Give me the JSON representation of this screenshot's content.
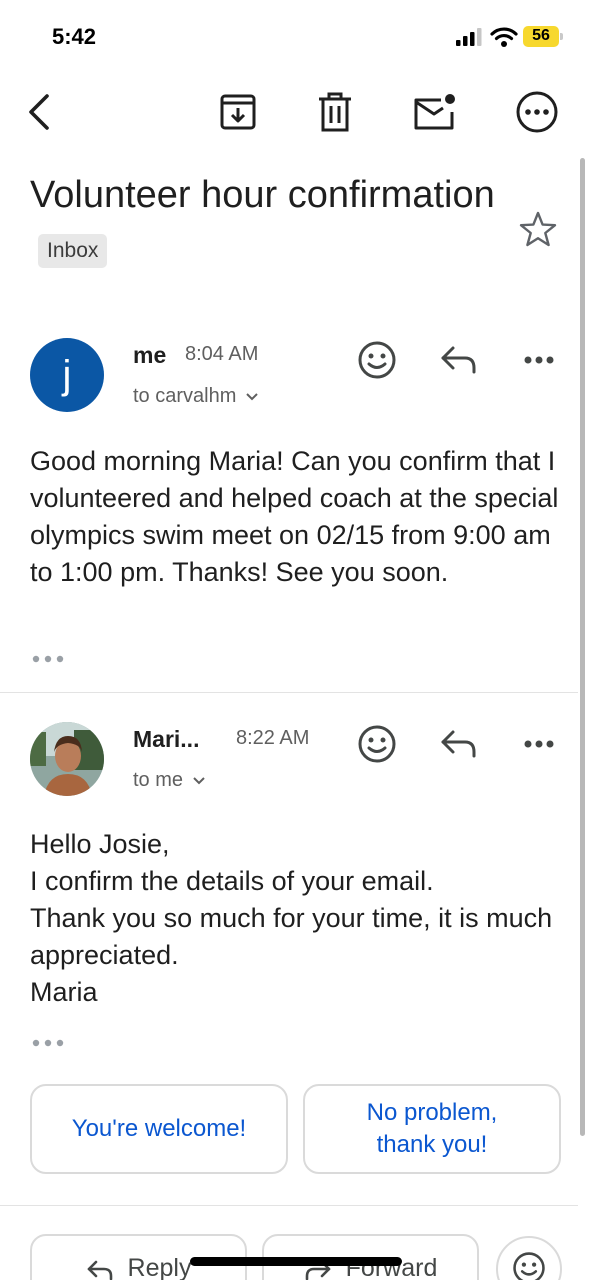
{
  "status_bar": {
    "time": "5:42",
    "battery_level": "56",
    "battery_color": "#f7d82e"
  },
  "toolbar": {
    "back_icon": "chevron-left-icon",
    "archive_icon": "archive-icon",
    "delete_icon": "trash-icon",
    "mark_unread_icon": "mail-unread-icon",
    "more_icon": "more-horizontal-icon"
  },
  "subject": {
    "title": "Volunteer hour confirmation",
    "label": "Inbox"
  },
  "messages": [
    {
      "avatar_letter": "j",
      "avatar_color": "#0b57a5",
      "sender": "me",
      "time": "8:04 AM",
      "recipient": "to carvalhm",
      "body": "Good morning Maria! Can you confirm that I volunteered and helped coach at the special olympics swim meet on 02/15 from 9:00 am to 1:00 pm. Thanks! See you soon."
    },
    {
      "avatar_image": "profile-photo",
      "sender": "Mari...",
      "time": "8:22 AM",
      "recipient": "to me",
      "body": "Hello Josie,\nI confirm the details of your email.\nThank you so much for your time, it is much appreciated.\nMaria"
    }
  ],
  "smart_replies": [
    "You're welcome!",
    "No problem,\nthank you!"
  ],
  "actions": {
    "reply": "Reply",
    "forward": "Forward"
  },
  "colors": {
    "accent": "#0b57d0",
    "chip_border": "#dadada"
  }
}
